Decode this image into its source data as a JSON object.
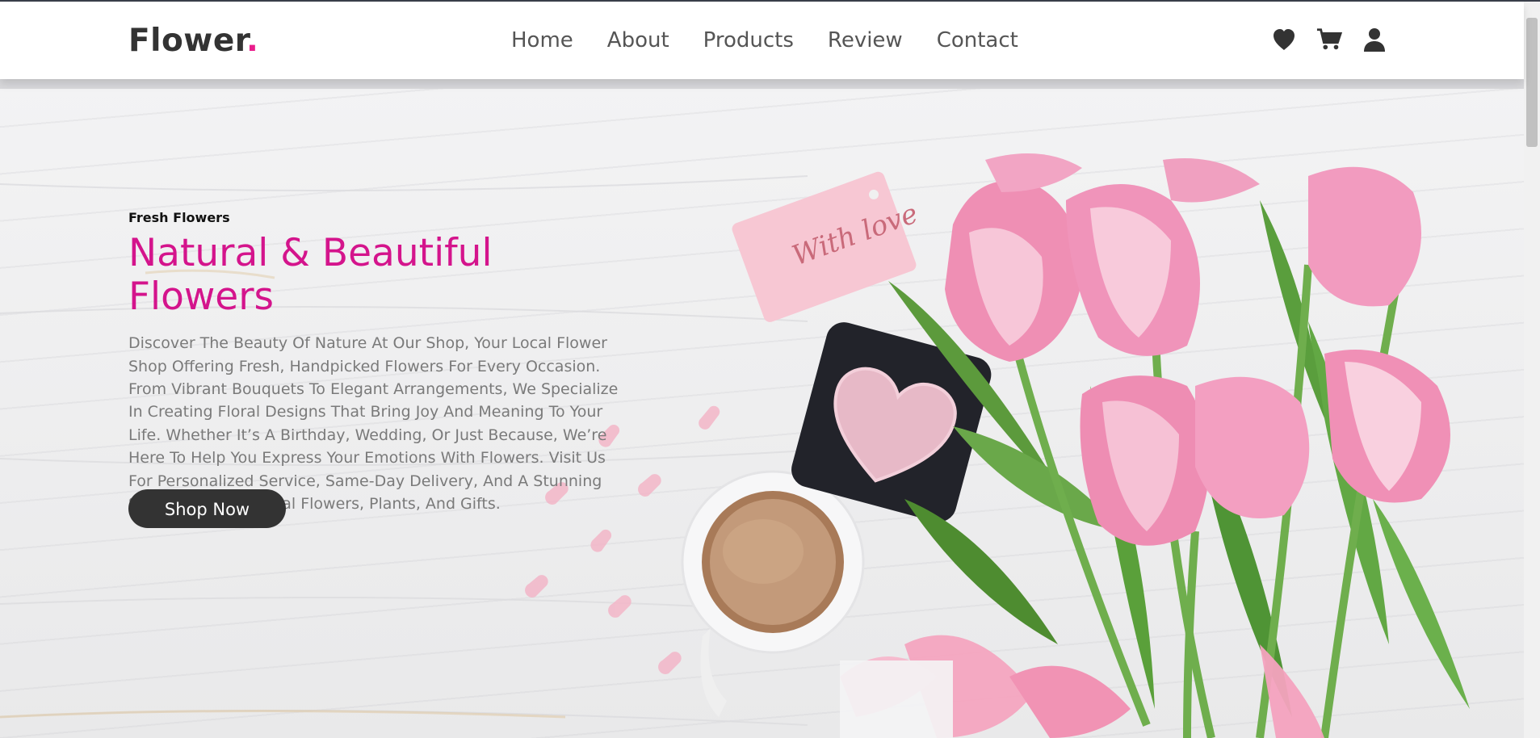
{
  "brand": {
    "name": "Flower",
    "dot": ".",
    "accent": "#e91e8c"
  },
  "nav": [
    {
      "label": "Home"
    },
    {
      "label": "About"
    },
    {
      "label": "Products"
    },
    {
      "label": "Review"
    },
    {
      "label": "Contact"
    }
  ],
  "header_icons": [
    "heart-icon",
    "cart-icon",
    "user-icon"
  ],
  "hero": {
    "eyebrow": "Fresh Flowers",
    "title": "Natural & Beautiful Flowers",
    "description": "Discover The Beauty Of Nature At Our Shop, Your Local Flower Shop Offering Fresh, Handpicked Flowers For Every Occasion. From Vibrant Bouquets To Elegant Arrangements, We Specialize In Creating Floral Designs That Bring Joy And Meaning To Your Life. Whether It’s A Birthday, Wedding, Or Just Because, We’re Here To Help You Express Your Emotions With Flowers. Visit Us For Personalized Service, Same-Day Delivery, And A Stunning Selection Of Seasonal Flowers, Plants, And Gifts.",
    "cta": "Shop Now",
    "title_color": "#d4148c",
    "tag_text": "With love"
  }
}
